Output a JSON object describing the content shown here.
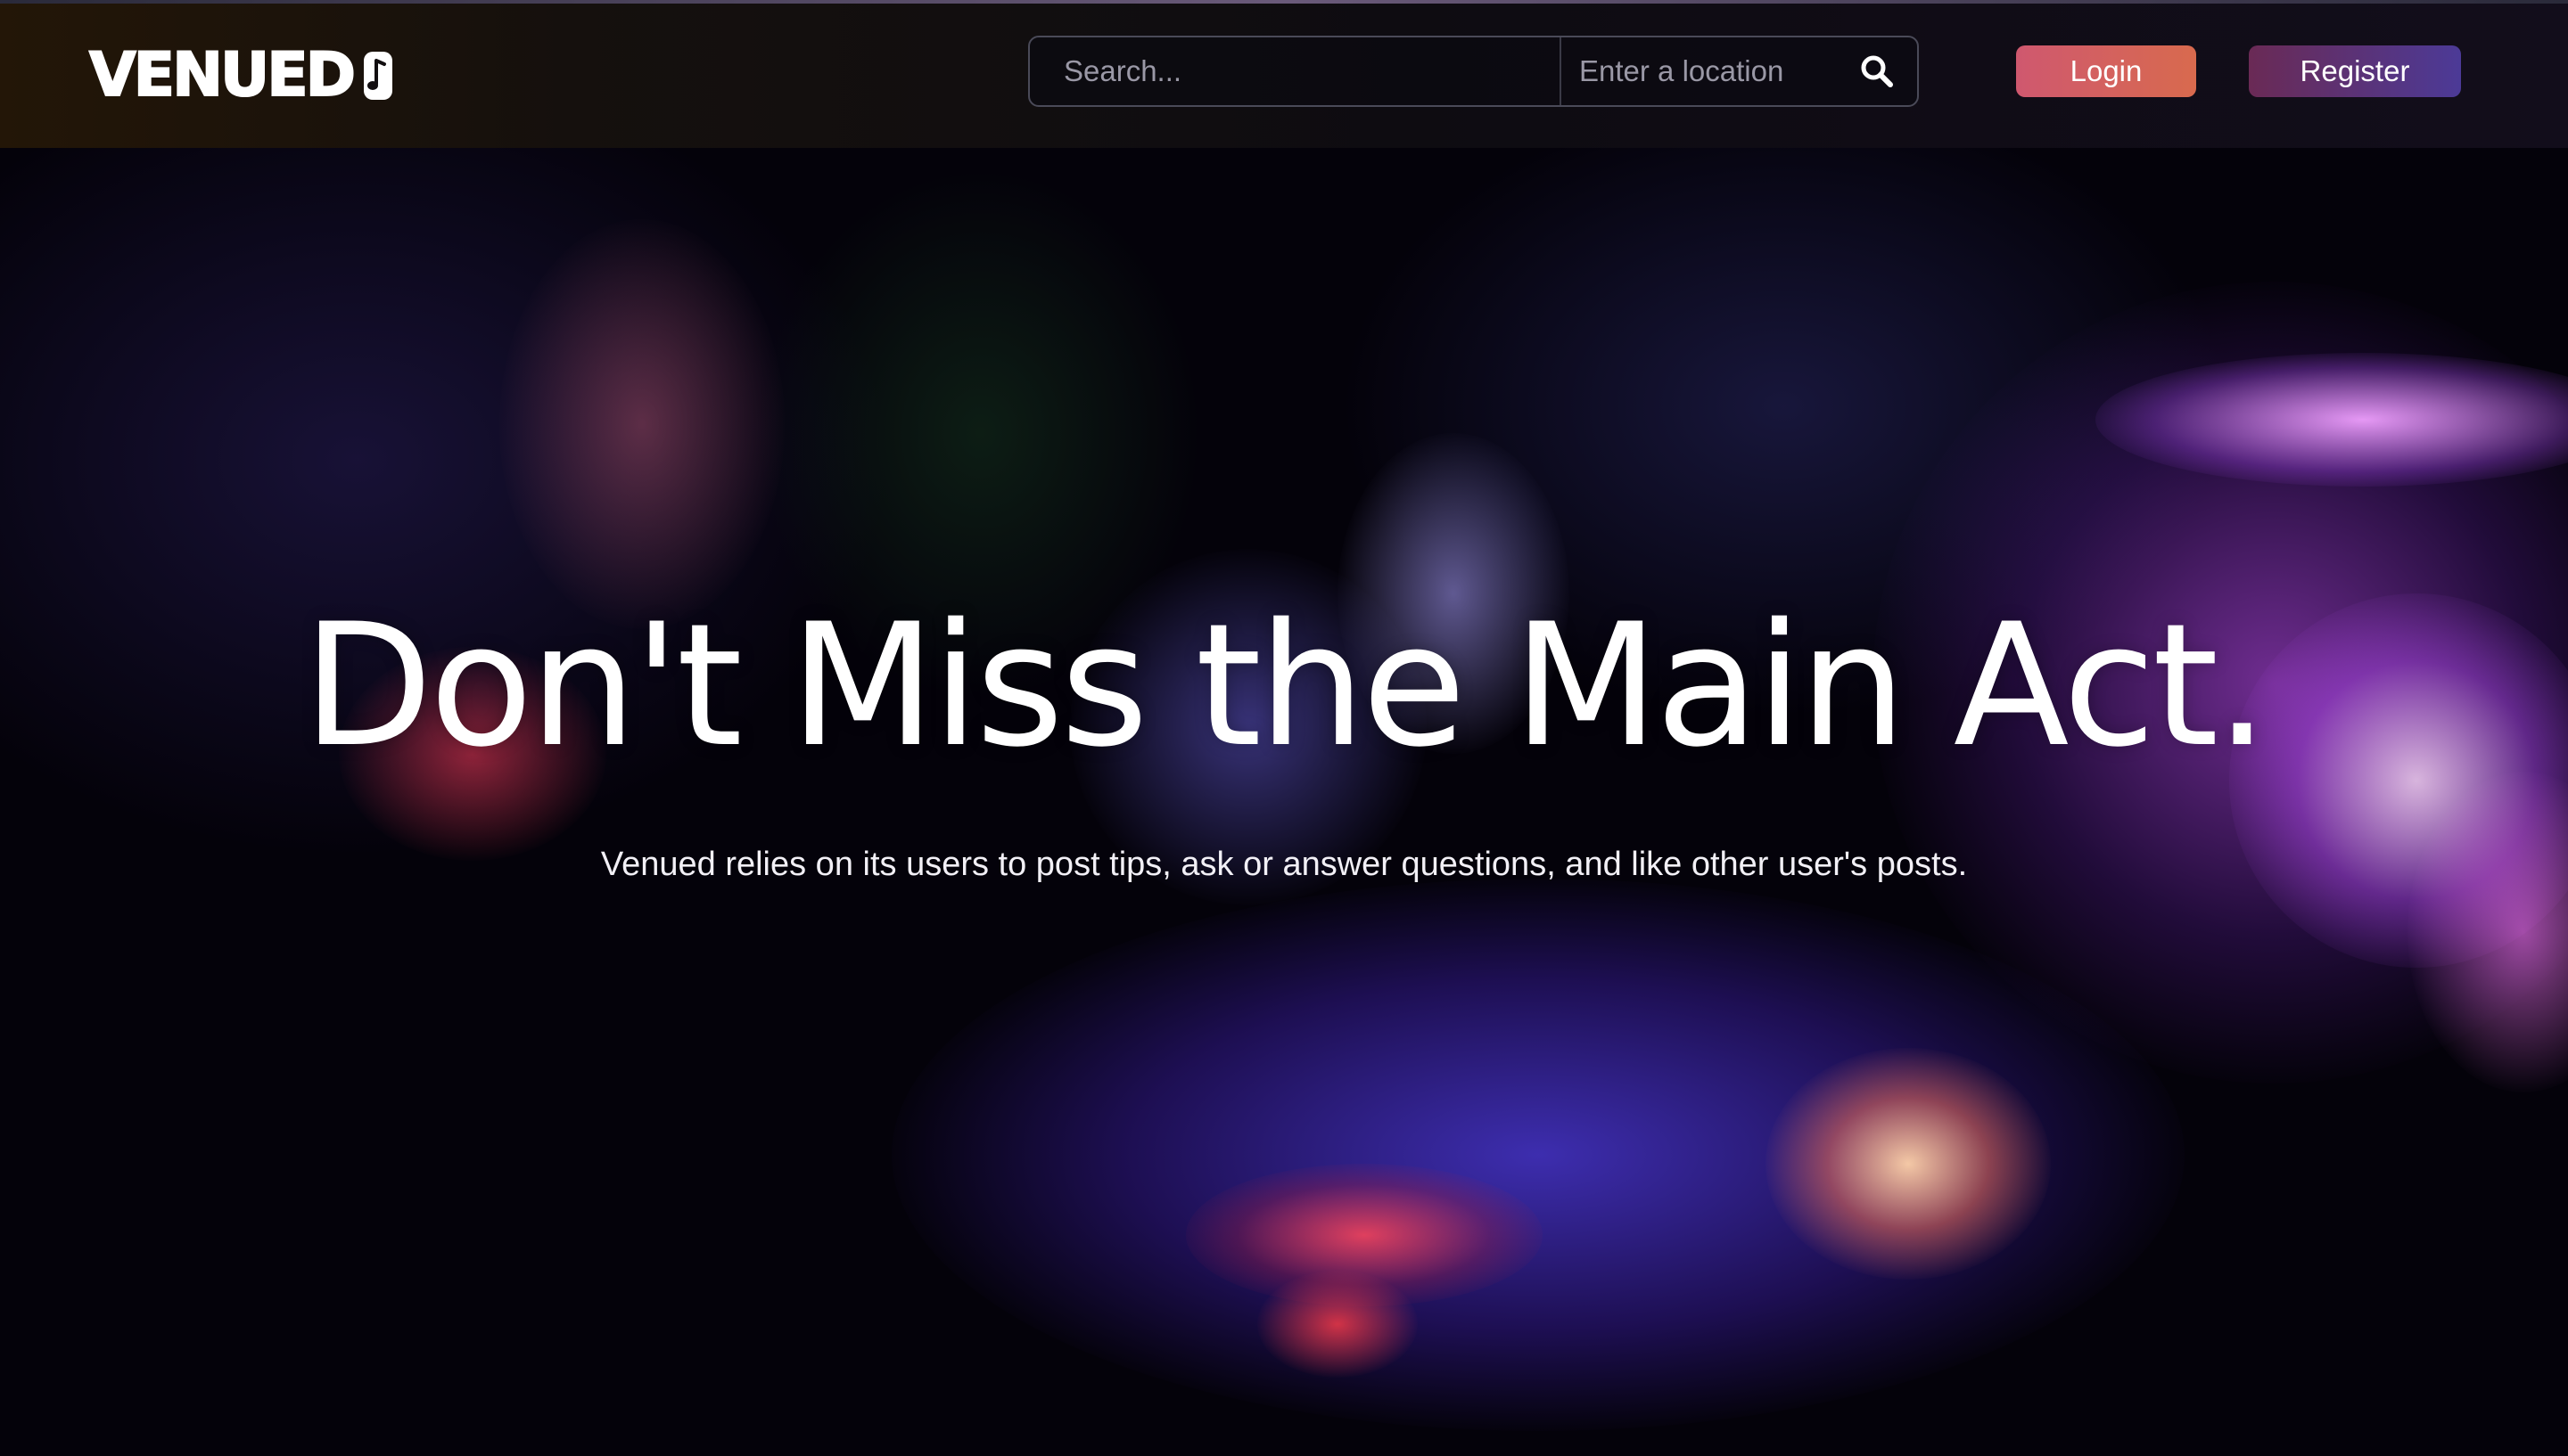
{
  "header": {
    "logo_text": "VENUED",
    "search_placeholder": "Search...",
    "location_placeholder": "Enter a location",
    "login_label": "Login",
    "register_label": "Register"
  },
  "hero": {
    "title": "Don't Miss the Main Act.",
    "subtitle": "Venued relies on its users to post tips, ask or answer questions, and like other user's posts."
  },
  "colors": {
    "login_gradient": [
      "#cf586f",
      "#d86a4e"
    ],
    "register_gradient": [
      "#6a2a55",
      "#4c3a97"
    ],
    "header_bg": "#120e10"
  },
  "icons": {
    "logo_icon": "music-note-icon",
    "search_icon": "search-icon"
  }
}
